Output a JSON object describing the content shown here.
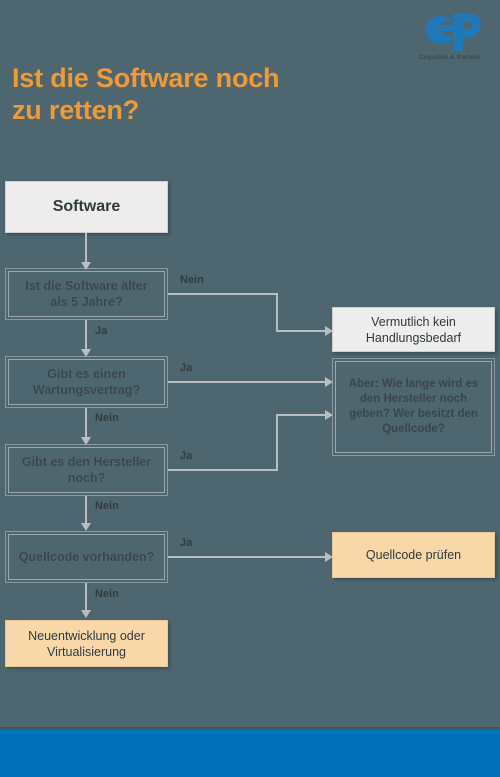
{
  "page": {
    "background_color": "#4d6670",
    "title_line1": "Ist die Software noch",
    "title_line2": "zu retten?",
    "title_color": "#ef9a36"
  },
  "logo": {
    "name": "cp-logo",
    "caption": "Cegedim & Partner",
    "color": "#1f78b8"
  },
  "flowchart": {
    "nodes": [
      {
        "id": "software",
        "label": "Software",
        "type": "start",
        "fill": "#ededed"
      },
      {
        "id": "age",
        "label": "Ist die Software älter als 5 Jahre?",
        "type": "decision"
      },
      {
        "id": "maintenance",
        "label": "Gibt es einen Wartungsvertrag?",
        "type": "decision"
      },
      {
        "id": "vendor",
        "label": "Gibt es den Hersteller noch?",
        "type": "decision"
      },
      {
        "id": "sourcecode",
        "label": "Quellcode vorhanden?",
        "type": "decision"
      },
      {
        "id": "rebuild",
        "label": "Neuentwicklung oder Virtualisierung",
        "type": "result",
        "fill": "#f8d8a8"
      },
      {
        "id": "noaction",
        "label": "Vermutlich kein Handlungsbedarf",
        "type": "result",
        "fill": "#ededed"
      },
      {
        "id": "caveat",
        "label": "Aber: Wie lange wird es den Hersteller noch geben? Wer besitzt den Quellcode?",
        "type": "note"
      },
      {
        "id": "checksource",
        "label": "Quellcode prüfen",
        "type": "result",
        "fill": "#f8d8a8"
      }
    ],
    "edges": [
      {
        "from": "software",
        "to": "age",
        "label": ""
      },
      {
        "from": "age",
        "to": "noaction",
        "label": "Nein"
      },
      {
        "from": "age",
        "to": "maintenance",
        "label": "Ja"
      },
      {
        "from": "maintenance",
        "to": "caveat",
        "label": "Ja"
      },
      {
        "from": "maintenance",
        "to": "vendor",
        "label": "Nein"
      },
      {
        "from": "vendor",
        "to": "caveat",
        "label": "Ja"
      },
      {
        "from": "vendor",
        "to": "sourcecode",
        "label": "Nein"
      },
      {
        "from": "sourcecode",
        "to": "checksource",
        "label": "Ja"
      },
      {
        "from": "sourcecode",
        "to": "rebuild",
        "label": "Nein"
      }
    ]
  },
  "footer": {
    "color": "#0071b9"
  }
}
